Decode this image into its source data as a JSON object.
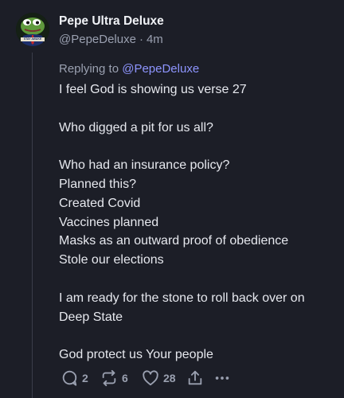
{
  "post": {
    "display_name": "Pepe Ultra Deluxe",
    "handle": "@PepeDeluxe",
    "separator": "·",
    "time": "4m",
    "avatar": {
      "icon": "pepe-frog-avatar",
      "caption": "STAY AWAKE"
    },
    "replying_prefix": "Replying to",
    "replying_to": "@PepeDeluxe",
    "lines": [
      "I feel God is showing us verse 27",
      "",
      "Who digged a pit for us all?",
      "",
      "Who had an insurance policy?",
      "Planned this?",
      "Created Covid",
      "Vaccines planned",
      "Masks as an outward proof of obedience",
      "Stole our elections",
      "",
      "I am ready for the stone to roll back over on",
      "Deep State",
      "",
      "God protect us Your people"
    ],
    "actions": {
      "reply_count": "2",
      "repost_count": "6",
      "like_count": "28"
    }
  },
  "colors": {
    "background": "#1c1e27",
    "text": "#e6e8ee",
    "muted": "#9aa0b0",
    "mention": "#8e95ff",
    "thread_line": "#3a3d4a"
  }
}
